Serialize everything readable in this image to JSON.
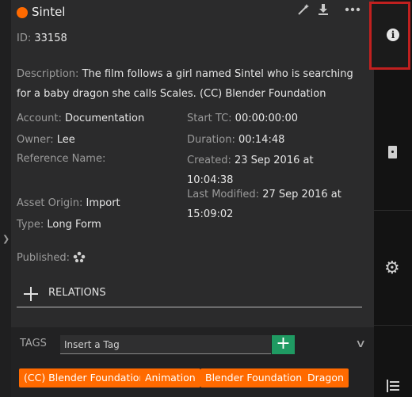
{
  "header": {
    "title": "Sintel",
    "status_color": "#ff6a00",
    "icons": [
      "magic-wand-icon",
      "download-icon",
      "more-icon"
    ]
  },
  "asset": {
    "id_label": "ID:",
    "id_value": "33158",
    "description_label": "Description:",
    "description_value": "The film follows a girl named Sintel who is searching for a baby dragon she calls Scales. (CC) Blender Foundation",
    "account_label": "Account:",
    "account_value": "Documentation",
    "owner_label": "Owner:",
    "owner_value": "Lee",
    "reference_label": "Reference Name:",
    "asset_origin_label": "Asset Origin:",
    "asset_origin_value": "Import",
    "type_label": "Type:",
    "type_value": "Long Form",
    "published_label": "Published:",
    "start_tc_label": "Start TC:",
    "start_tc_value": "00:00:00:00",
    "duration_label": "Duration:",
    "duration_value": "00:14:48",
    "created_label": "Created:",
    "created_date": "23 Sep 2016 at",
    "created_time": "10:04:38",
    "modified_label": "Last Modified:",
    "modified_date": "27 Sep 2016 at",
    "modified_time": "15:09:02"
  },
  "relations": {
    "label": "RELATIONS"
  },
  "tags": {
    "label": "TAGS",
    "input_placeholder": "Insert a Tag",
    "add_symbol": "+",
    "chips": [
      "(CC) Blender Foundation",
      "Animation",
      "Blender Foundation",
      "Dragon"
    ],
    "chip_color": "#ff6a00"
  },
  "sidebar": {
    "active_highlight_color": "#c0201f",
    "icons": [
      "info-icon",
      "drive-icon",
      "gear-icon",
      "list-icon"
    ]
  }
}
